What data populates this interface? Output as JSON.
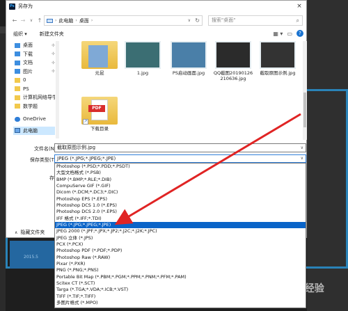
{
  "background": {
    "year_text": "2015.5",
    "watermark": "Baidu 经验"
  },
  "dialog": {
    "title": "另存为",
    "close": "×",
    "nav": {
      "back": "←",
      "forward": "→",
      "recent": "∨",
      "up": "↑"
    },
    "breadcrumb": [
      "此电脑",
      "桌面"
    ],
    "search_placeholder": "搜索\"桌面\"",
    "toolbar": {
      "organize": "组织 ▾",
      "new_folder": "新建文件夹"
    },
    "nav_pane": [
      {
        "label": "桌面",
        "pinned": true
      },
      {
        "label": "下载",
        "pinned": true
      },
      {
        "label": "文档",
        "pinned": true
      },
      {
        "label": "图片",
        "pinned": true
      },
      {
        "label": "0",
        "pinned": false
      },
      {
        "label": "PS",
        "pinned": false
      },
      {
        "label": "计算机网络导学",
        "pinned": false
      },
      {
        "label": "数学题",
        "pinned": false
      },
      {
        "label": "OneDrive",
        "pinned": false
      },
      {
        "label": "此电脑",
        "pinned": false
      }
    ],
    "files": [
      {
        "name": "元昆"
      },
      {
        "name": "1.jpg"
      },
      {
        "name": "PS启动画面.jpg"
      },
      {
        "name": "QQ截图20190126210636.jpg"
      },
      {
        "name": "截取原图示例.jpg"
      },
      {
        "name": "下载目录"
      }
    ],
    "pdf_badge": "PDF",
    "filename_label": "文件名(N):",
    "filename_value": "截取原图示例.jpg",
    "savetype_label": "保存类型(T):",
    "savetype_value": "JPEG (*.JPG;*.JPEG;*.JPE)",
    "hide_folders": "隐藏文件夹",
    "dropdown_options": [
      "Photoshop (*.PSD;*.PDD;*.PSDT)",
      "大型文档格式 (*.PSB)",
      "BMP (*.BMP;*.RLE;*.DIB)",
      "CompuServe GIF (*.GIF)",
      "Dicom (*.DCM;*.DC3;*.DIC)",
      "Photoshop EPS (*.EPS)",
      "Photoshop DCS 1.0 (*.EPS)",
      "Photoshop DCS 2.0 (*.EPS)",
      "IFF 格式 (*.IFF;*.TDI)",
      "JPEG (*.JPG;*.JPEG;*.JPE)",
      "JPEG 2000 (*.JPF;*.JPX;*.JP2;*.J2C;*.J2K;*.JPC)",
      "JPEG 立体 (*.JPS)",
      "PCX (*.PCX)",
      "Photoshop PDF (*.PDF;*.PDP)",
      "Photoshop Raw (*.RAW)",
      "Pixar (*.PXR)",
      "PNG (*.PNG;*.PNS)",
      "Portable Bit Map (*.PBM;*.PGM;*.PPM;*.PNM;*.PFM;*.PAM)",
      "Scitex CT (*.SCT)",
      "Targa (*.TGA;*.VDA;*.ICB;*.VST)",
      "TIFF (*.TIF;*.TIFF)",
      "多图片格式 (*.MPO)"
    ],
    "selected_option_index": 9
  },
  "colors": {
    "selection": "#0a64c8",
    "annotation_arrow": "#e02424",
    "ps_frame": "#2a83b8"
  }
}
